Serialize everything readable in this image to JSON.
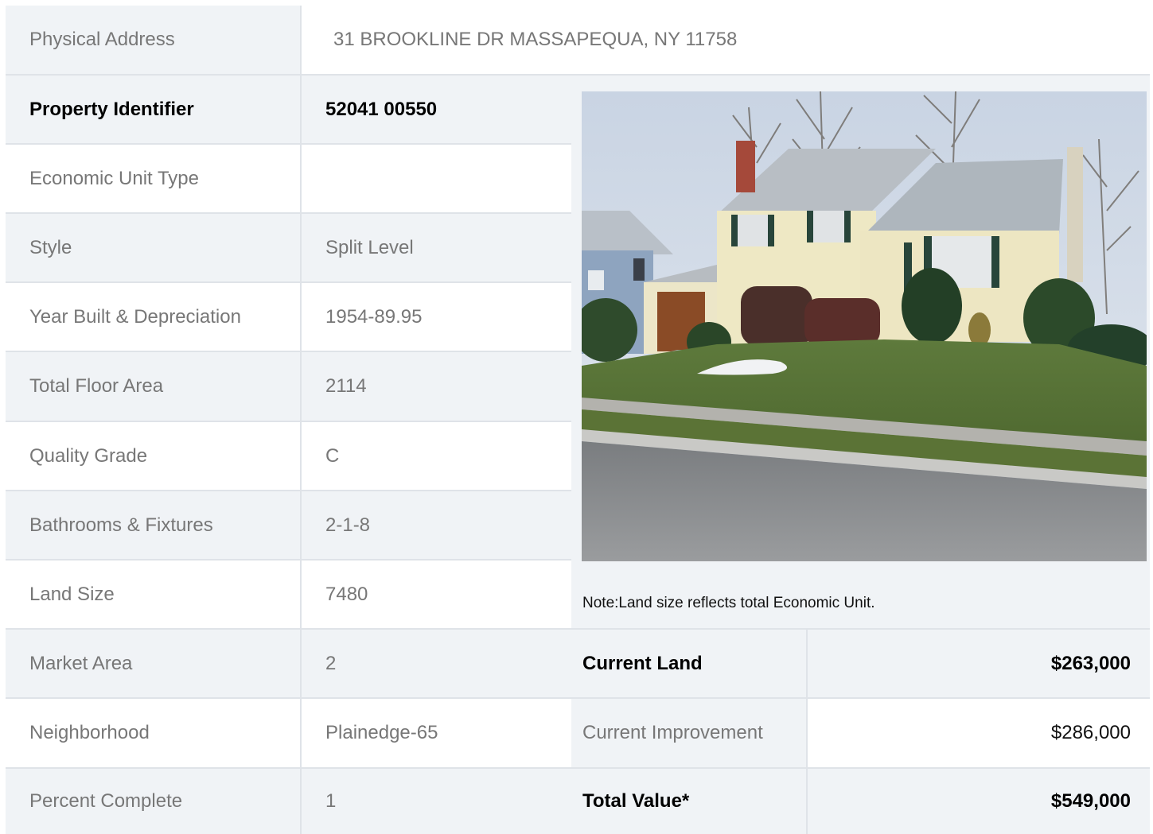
{
  "header": {
    "label": "Physical Address",
    "value": "31  BROOKLINE DR  MASSAPEQUA, NY  11758"
  },
  "details": [
    {
      "label": "Property Identifier",
      "value": "52041  00550"
    },
    {
      "label": "Economic Unit Type",
      "value": ""
    },
    {
      "label": "Style",
      "value": "Split Level"
    },
    {
      "label": "Year Built & Depreciation",
      "value": "1954-89.95"
    },
    {
      "label": "Total Floor Area",
      "value": "2114"
    },
    {
      "label": "Quality Grade",
      "value": "C"
    },
    {
      "label": "Bathrooms & Fixtures",
      "value": "2-1-8"
    },
    {
      "label": "Land Size",
      "value": "7480"
    },
    {
      "label": "Market Area",
      "value": "2"
    },
    {
      "label": "Neighborhood",
      "value": "Plainedge-65"
    },
    {
      "label": "Percent Complete",
      "value": "1"
    }
  ],
  "note": "Note:Land size reflects total Economic Unit.",
  "values": [
    {
      "label": "Current Land",
      "value": "$263,000"
    },
    {
      "label": "Current Improvement",
      "value": "$286,000"
    },
    {
      "label": "Total Value*",
      "value": "$549,000"
    }
  ],
  "colors": {
    "border": "#dfe3e8",
    "shaded_row": "#f0f3f6",
    "text_muted": "#777777",
    "text_bold": "#000000"
  },
  "photo_icon": "house-photo"
}
